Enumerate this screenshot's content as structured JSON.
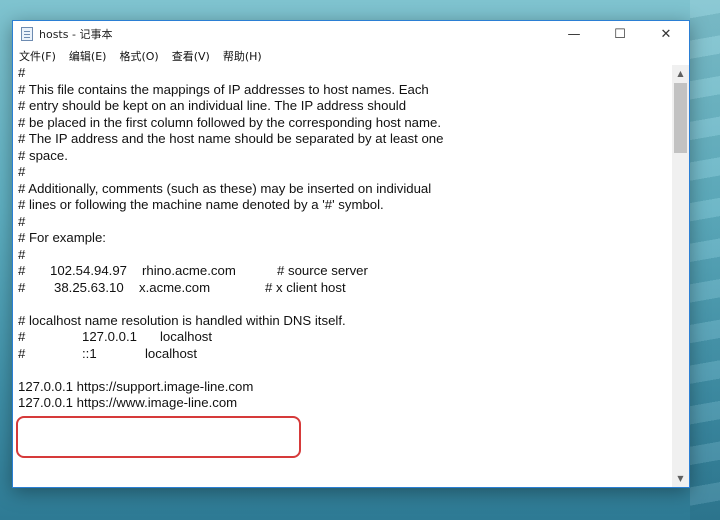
{
  "window": {
    "title": "hosts - 记事本",
    "controls": {
      "minimize": "—",
      "maximize": "☐",
      "close": "✕"
    }
  },
  "menu": [
    "文件(F)",
    "编辑(E)",
    "格式(O)",
    "查看(V)",
    "帮助(H)"
  ],
  "lines": [
    "#",
    "# This file contains the mappings of IP addresses to host names. Each",
    "# entry should be kept on an individual line. The IP address should",
    "# be placed in the first column followed by the corresponding host name.",
    "# The IP address and the host name should be separated by at least one",
    "# space.",
    "#",
    "# Additionally, comments (such as these) may be inserted on individual",
    "# lines or following the machine name denoted by a '#' symbol.",
    "#",
    "# For example:",
    "#",
    "",
    "",
    "",
    "# localhost name resolution is handled within DNS itself.",
    "",
    "",
    "",
    "127.0.0.1 https://support.image-line.com",
    "127.0.0.1 https://www.image-line.com"
  ],
  "example_rows": [
    {
      "hash": "#",
      "ip": "102.54.94.97",
      "host": "rhino.acme.com",
      "comment": "# source server"
    },
    {
      "hash": "#",
      "ip": "38.25.63.10",
      "host": "x.acme.com",
      "comment": "# x client host"
    }
  ],
  "localhost_rows": [
    {
      "hash": "#",
      "ip": "127.0.0.1",
      "host": "localhost"
    },
    {
      "hash": "#",
      "ip": "::1",
      "host": "localhost"
    }
  ],
  "icons": {
    "app": "notepad-icon",
    "scroll_up": "▲",
    "scroll_down": "▼"
  },
  "colors": {
    "highlight": "#d63a3a",
    "window_border": "#2b7fd4",
    "scrollbar_thumb": "#c2c2c2"
  }
}
